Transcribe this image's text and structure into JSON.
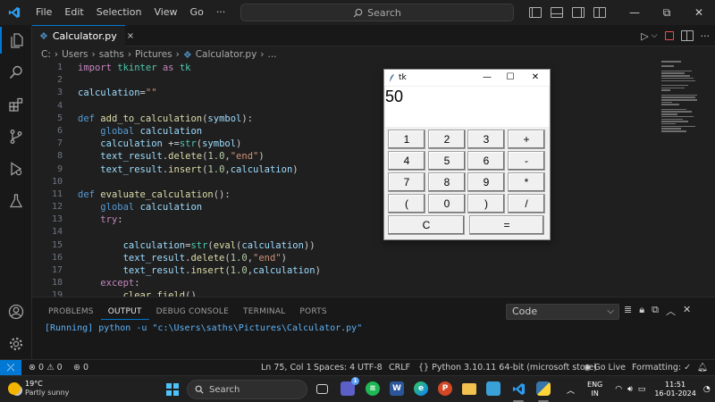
{
  "menu": [
    "File",
    "Edit",
    "Selection",
    "View",
    "Go",
    "···"
  ],
  "command_center": {
    "placeholder": "Search"
  },
  "tab": {
    "filename": "Calculator.py",
    "close": "×"
  },
  "breadcrumb": {
    "drive": "C:",
    "sep": "›",
    "p1": "Users",
    "p2": "saths",
    "p3": "Pictures",
    "file": "Calculator.py",
    "more": "..."
  },
  "code": {
    "line_numbers": [
      "1",
      "2",
      "3",
      "4",
      "5",
      "6",
      "7",
      "8",
      "9",
      "10",
      "11",
      "12",
      "13",
      "14",
      "15",
      "16",
      "17",
      "18",
      "19"
    ],
    "l1": {
      "import": "import",
      "mod": "tkinter",
      "as": "as",
      "alias": "tk"
    },
    "l3": {
      "var": "calculation",
      "eq": "=",
      "str": "\"\""
    },
    "l5": {
      "def": "def",
      "name": "add_to_calculation",
      "open": "(",
      "param": "symbol",
      "close": "):"
    },
    "l6": {
      "global": "global",
      "var": "calculation"
    },
    "l7": {
      "var": "calculation",
      "op": " +=",
      "fn": "str",
      "open": "(",
      "arg": "symbol",
      "close": ")"
    },
    "l8": {
      "obj": "text_result",
      "dot": ".",
      "fn": "delete",
      "open": "(",
      "num": "1.0",
      "comma": ",",
      "str": "\"end\"",
      "close": ")"
    },
    "l9": {
      "obj": "text_result",
      "dot": ".",
      "fn": "insert",
      "open": "(",
      "num": "1.0",
      "comma": ",",
      "arg": "calculation",
      "close": ")"
    },
    "l11": {
      "def": "def",
      "name": "evaluate_calculation",
      "rest": "():"
    },
    "l12": {
      "global": "global",
      "var": "calculation"
    },
    "l13": {
      "try": "try",
      "colon": ":"
    },
    "l15": {
      "var": "calculation",
      "eq": "=",
      "fn1": "str",
      "open1": "(",
      "fn2": "eval",
      "open2": "(",
      "arg": "calculation",
      "close": "))"
    },
    "l16": {
      "obj": "text_result",
      "dot": ".",
      "fn": "delete",
      "open": "(",
      "num": "1.0",
      "comma": ",",
      "str": "\"end\"",
      "close": ")"
    },
    "l17": {
      "obj": "text_result",
      "dot": ".",
      "fn": "insert",
      "open": "(",
      "num": "1.0",
      "comma": ",",
      "arg": "calculation",
      "close": ")"
    },
    "l18": {
      "except": "except",
      "colon": ":"
    },
    "l19": {
      "fn": "clear_field",
      "rest": "()"
    }
  },
  "tk_window": {
    "title": "tk",
    "minimize": "—",
    "maximize": "☐",
    "close": "✕",
    "display": "50",
    "buttons": [
      "1",
      "2",
      "3",
      "+",
      "4",
      "5",
      "6",
      "-",
      "7",
      "8",
      "9",
      "*",
      "(",
      "0",
      ")",
      "/"
    ],
    "clear": "C",
    "equals": "="
  },
  "panel": {
    "tabs": [
      "PROBLEMS",
      "OUTPUT",
      "DEBUG CONSOLE",
      "TERMINAL",
      "PORTS"
    ],
    "select": "Code",
    "output": "[Running] python -u \"c:\\Users\\saths\\Pictures\\Calculator.py\""
  },
  "statusbar": {
    "errors": "0",
    "warnings": "0",
    "ports": "0",
    "position": "Ln 75, Col 1",
    "spaces": "Spaces: 4",
    "encoding": "UTF-8",
    "eol": "CRLF",
    "language": "Python",
    "interpreter": "3.10.11 64-bit (microsoft store)",
    "golive": "Go Live",
    "formatting": "Formatting: ✓"
  },
  "taskbar": {
    "temp": "19°C",
    "weather": "Partly sunny",
    "search": "Search",
    "chat_badge": "1",
    "lang1": "ENG",
    "lang2": "IN",
    "time": "11:51",
    "date": "16-01-2024"
  },
  "colors": {
    "accent": "#0078d4",
    "editor_bg": "#1f1f1f",
    "sidebar_bg": "#181818",
    "output_text": "#5fb3f9"
  }
}
